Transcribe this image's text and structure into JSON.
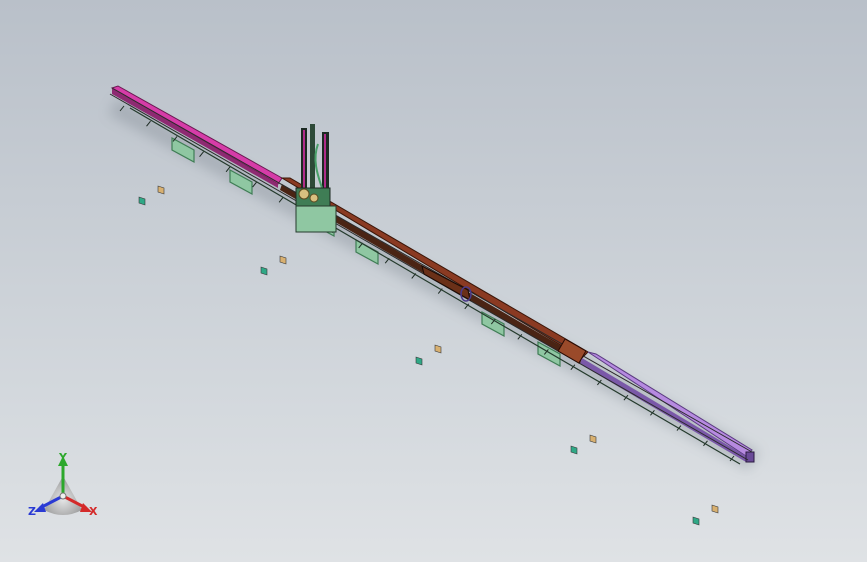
{
  "viewport": {
    "background_top": "#b9c0c9",
    "background_bottom": "#dfe2e5"
  },
  "model": {
    "colors": {
      "rail_magenta": "#d63ca8",
      "rail_brown": "#8a3a22",
      "rail_violet": "#b68ae0",
      "rail_dark_edge": "#2a2a2a",
      "support_green": "#3f7d55",
      "support_fill": "#8fc7a2",
      "tower_dark": "#1c2a22",
      "tower_magenta": "#b02c8a",
      "marker_teal": "#2fa886",
      "marker_tan": "#d8b070"
    }
  },
  "triad": {
    "x_label": "X",
    "y_label": "Y",
    "z_label": "Z",
    "x_color": "#d42a2a",
    "y_color": "#2ca82c",
    "z_color": "#2a3ad4"
  }
}
